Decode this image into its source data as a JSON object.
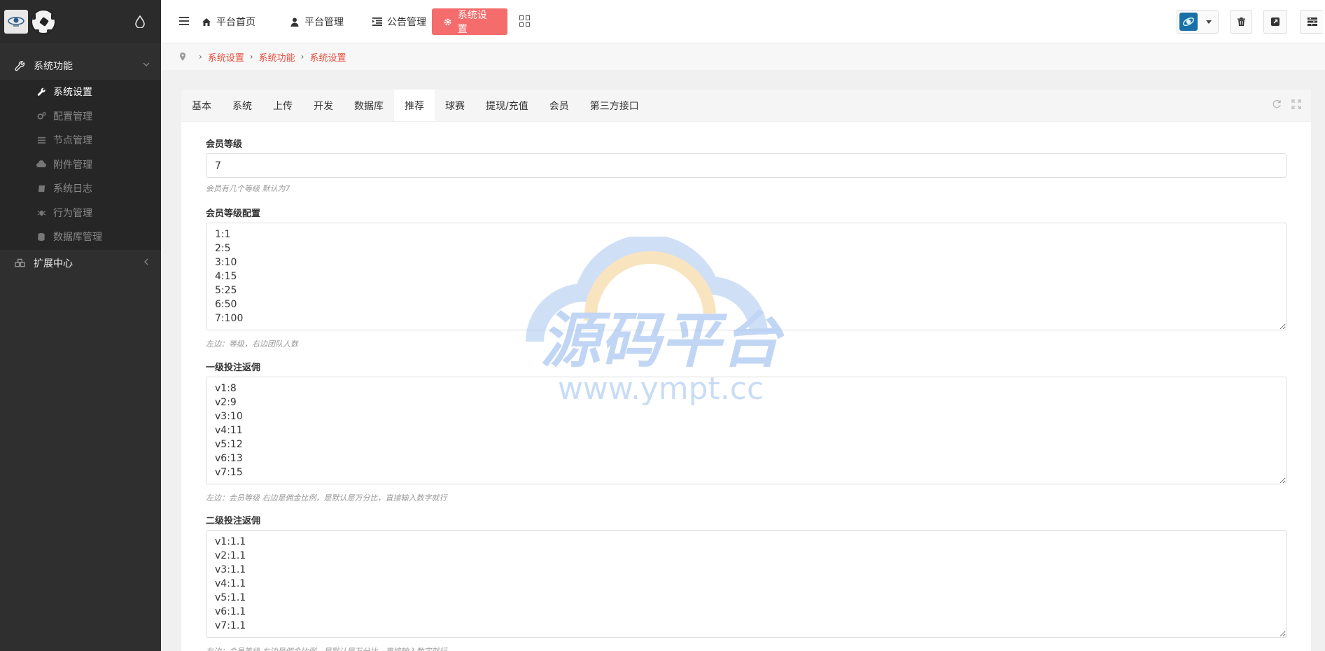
{
  "sidebar": {
    "groups": [
      {
        "label": "系统功能",
        "icon": "wrench-icon",
        "expanded": true
      },
      {
        "label": "扩展中心",
        "icon": "cubes-icon",
        "expanded": false
      }
    ],
    "items": [
      {
        "label": "系统设置",
        "icon": "wrench-icon",
        "active": true
      },
      {
        "label": "配置管理",
        "icon": "gears-icon",
        "active": false
      },
      {
        "label": "节点管理",
        "icon": "list-icon",
        "active": false
      },
      {
        "label": "附件管理",
        "icon": "cloud-icon",
        "active": false
      },
      {
        "label": "系统日志",
        "icon": "book-icon",
        "active": false
      },
      {
        "label": "行为管理",
        "icon": "bug-icon",
        "active": false
      },
      {
        "label": "数据库管理",
        "icon": "database-icon",
        "active": false
      }
    ]
  },
  "header": {
    "nav": [
      {
        "label": "平台首页",
        "icon": "home-icon"
      },
      {
        "label": "平台管理",
        "icon": "user-icon"
      },
      {
        "label": "公告管理",
        "icon": "list-indent-icon"
      },
      {
        "label": "系统设置",
        "icon": "gear-icon",
        "active": true
      }
    ]
  },
  "breadcrumb": [
    "系统设置",
    "系统功能",
    "系统设置"
  ],
  "tabs": [
    {
      "label": "基本"
    },
    {
      "label": "系统"
    },
    {
      "label": "上传"
    },
    {
      "label": "开发"
    },
    {
      "label": "数据库"
    },
    {
      "label": "推荐",
      "active": true
    },
    {
      "label": "球赛"
    },
    {
      "label": "提现/充值"
    },
    {
      "label": "会员"
    },
    {
      "label": "第三方接口"
    }
  ],
  "form": {
    "member_level": {
      "label": "会员等级",
      "value": "7",
      "help": "会员有几个等级 默认为7"
    },
    "member_level_config": {
      "label": "会员等级配置",
      "value": "1:1\n2:5\n3:10\n4:15\n5:25\n6:50\n7:100",
      "help": "左边：等级，右边团队人数"
    },
    "level1_rebate": {
      "label": "一级投注返佣",
      "value": "v1:8\nv2:9\nv3:10\nv4:11\nv5:12\nv6:13\nv7:15",
      "help": "左边：会员等级 右边是佣金比例，是默认是万分比，直接输入数字就行"
    },
    "level2_rebate": {
      "label": "二级投注返佣",
      "value": "v1:1.1\nv2:1.1\nv3:1.1\nv4:1.1\nv5:1.1\nv6:1.1\nv7:1.1",
      "help": "左边：会员等级 右边是佣金比例，是默认是万分比，直接输入数字就行"
    }
  },
  "watermark": {
    "title": "源码平台",
    "url": "www.ympt.cc"
  },
  "colors": {
    "accent": "#f56c6c",
    "sidebar_bg": "#2f2f2f",
    "crumb": "#e74c3c"
  }
}
